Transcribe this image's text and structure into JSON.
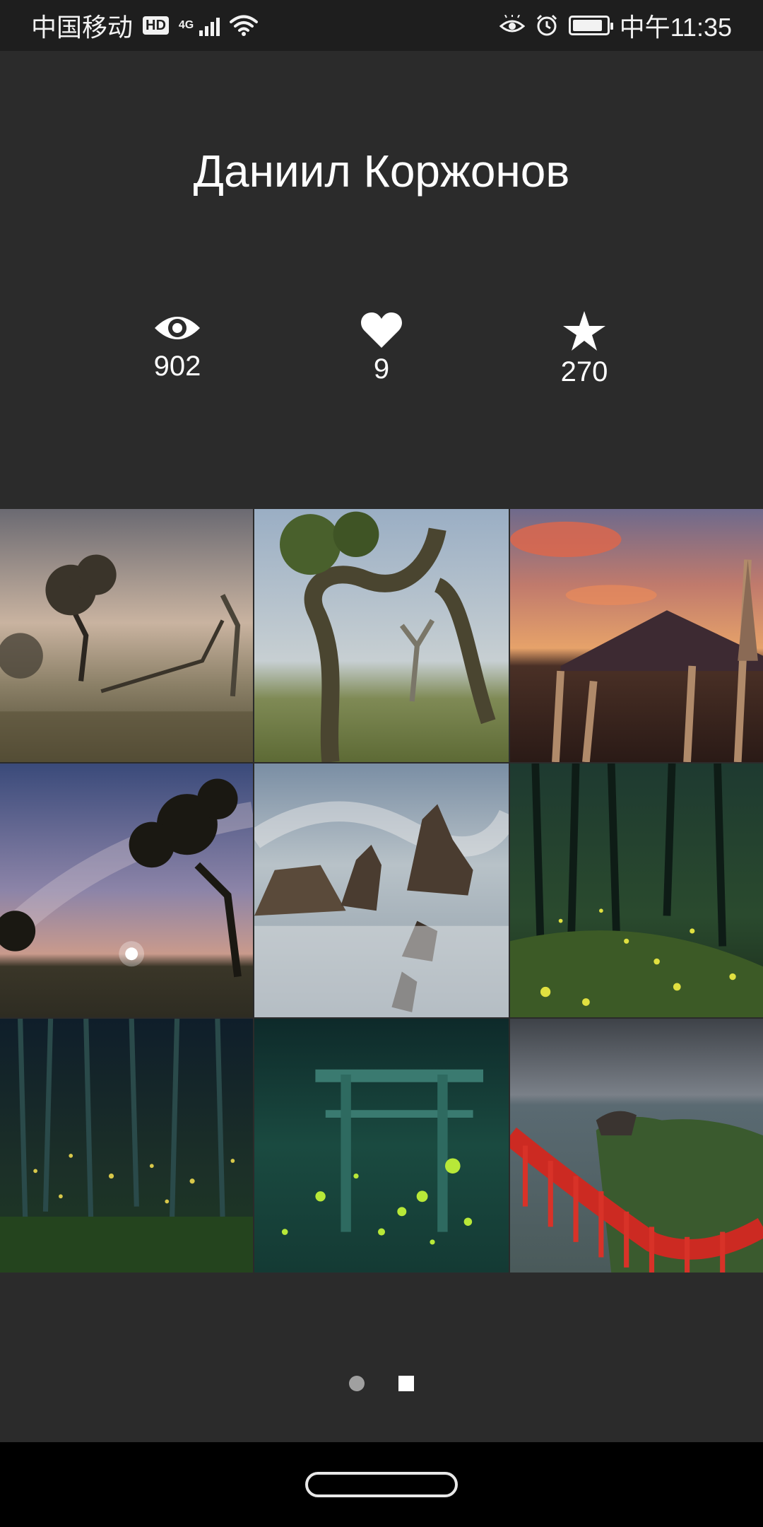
{
  "status_bar": {
    "carrier": "中国移动",
    "hd": "HD",
    "network": "4G",
    "time": "中午11:35",
    "battery_level": 0.9,
    "icons": [
      "hd-icon",
      "signal-icon",
      "wifi-icon",
      "eye-icon",
      "alarm-icon",
      "battery-icon"
    ]
  },
  "profile": {
    "name": "Даниил Коржонов"
  },
  "stats": {
    "views": "902",
    "likes": "9",
    "favorites": "270",
    "icons": [
      "eye-icon",
      "heart-icon",
      "star-icon"
    ]
  },
  "gallery": {
    "photos": [
      "foggy-trees",
      "twisted-tree",
      "volcano-sunset",
      "milky-way-tree",
      "misty-rocks",
      "bamboo-fireflies",
      "bamboo-forest-night",
      "torii-fireflies",
      "red-torii-coast"
    ]
  },
  "pager": {
    "pages": 2,
    "current": 2
  },
  "colors": {
    "background": "#2b2b2b",
    "status_bar": "#1e1e1e",
    "nav_bar": "#000000",
    "text": "#ffffff"
  }
}
